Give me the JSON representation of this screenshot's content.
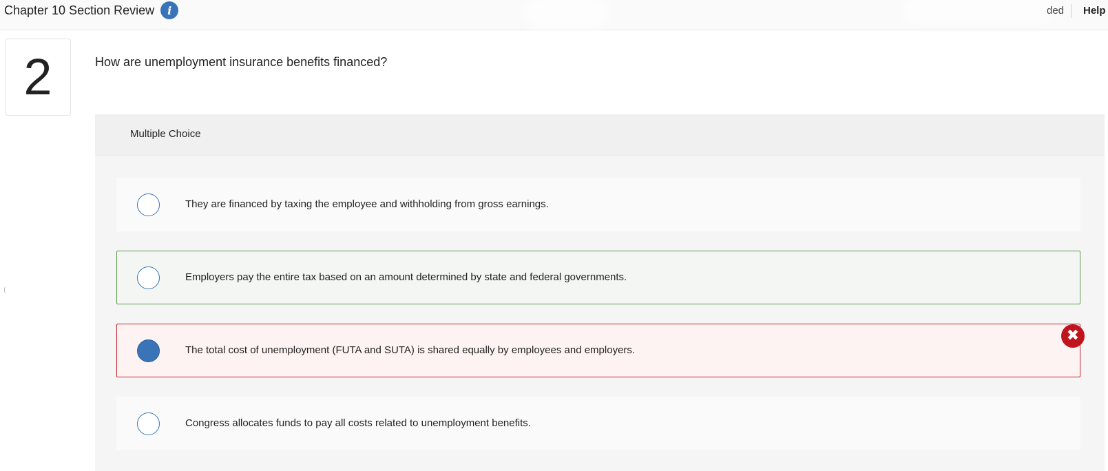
{
  "header": {
    "title": "Chapter 10 Section Review",
    "saved_status": "ded",
    "help_label": "Help"
  },
  "question": {
    "number": "2",
    "text": "How are unemployment insurance benefits financed?",
    "type_label": "Multiple Choice"
  },
  "choices": [
    {
      "text": "They are financed by taxing the employee and withholding from gross earnings.",
      "selected": false,
      "status": "none"
    },
    {
      "text": "Employers pay the entire tax based on an amount determined by state and federal governments.",
      "selected": false,
      "status": "correct"
    },
    {
      "text": "The total cost of unemployment (FUTA and SUTA) is shared equally by employees and employers.",
      "selected": true,
      "status": "incorrect"
    },
    {
      "text": "Congress allocates funds to pay all costs related to unemployment benefits.",
      "selected": false,
      "status": "none"
    }
  ],
  "colors": {
    "accent": "#3a74b8",
    "correct_border": "#5a9a4a",
    "incorrect_border": "#c0212c",
    "incorrect_icon": "#c0141d"
  },
  "icons": {
    "info": "info-icon",
    "incorrect": "x-icon"
  }
}
